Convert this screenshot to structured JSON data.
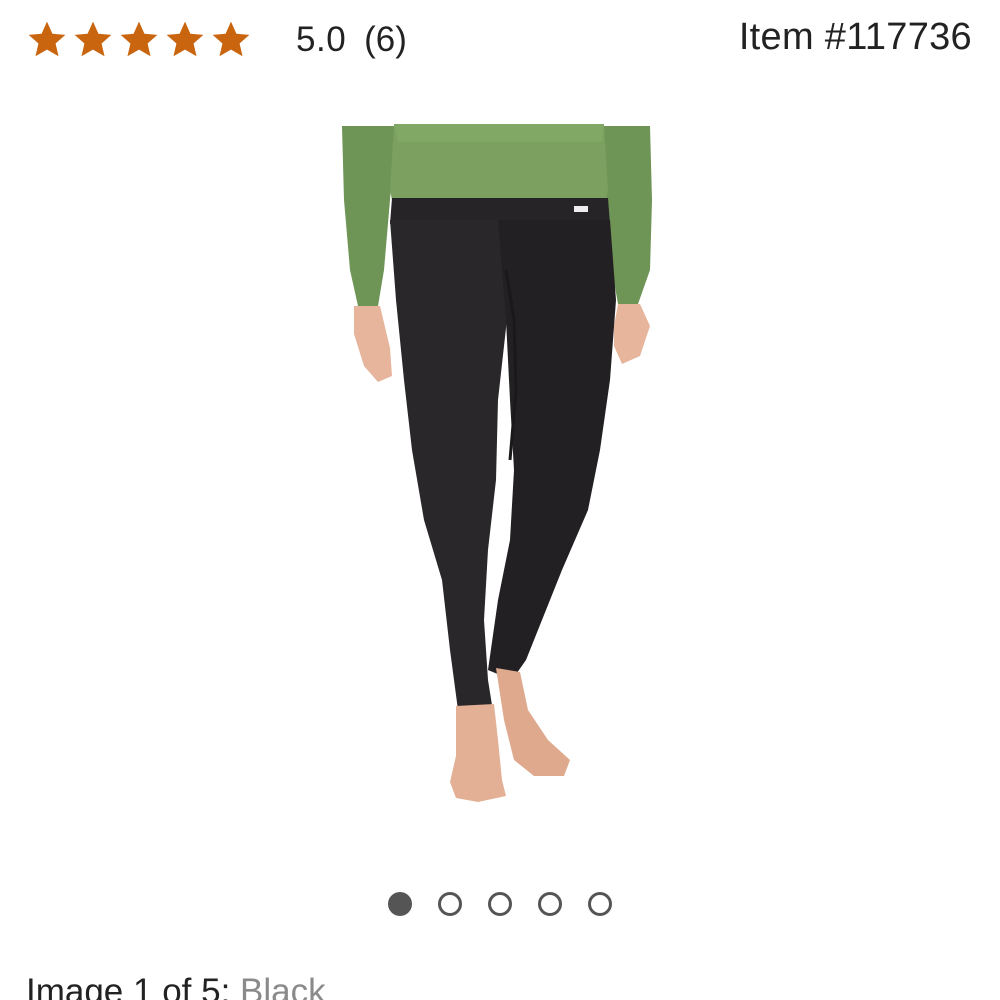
{
  "rating": {
    "stars_filled": 5,
    "stars_total": 5,
    "score": "5.0",
    "count": "(6)",
    "star_color": "#c9650f"
  },
  "item": {
    "number_label": "Item #117736"
  },
  "gallery": {
    "image_icon": "product-photo-leggings",
    "total_images": 5,
    "active_index": 1,
    "caption_prefix": "Image 1 of 5:",
    "caption_color": "Black"
  },
  "colors": {
    "text": "#222222",
    "muted": "#8a8a8a",
    "dot": "#555555"
  }
}
